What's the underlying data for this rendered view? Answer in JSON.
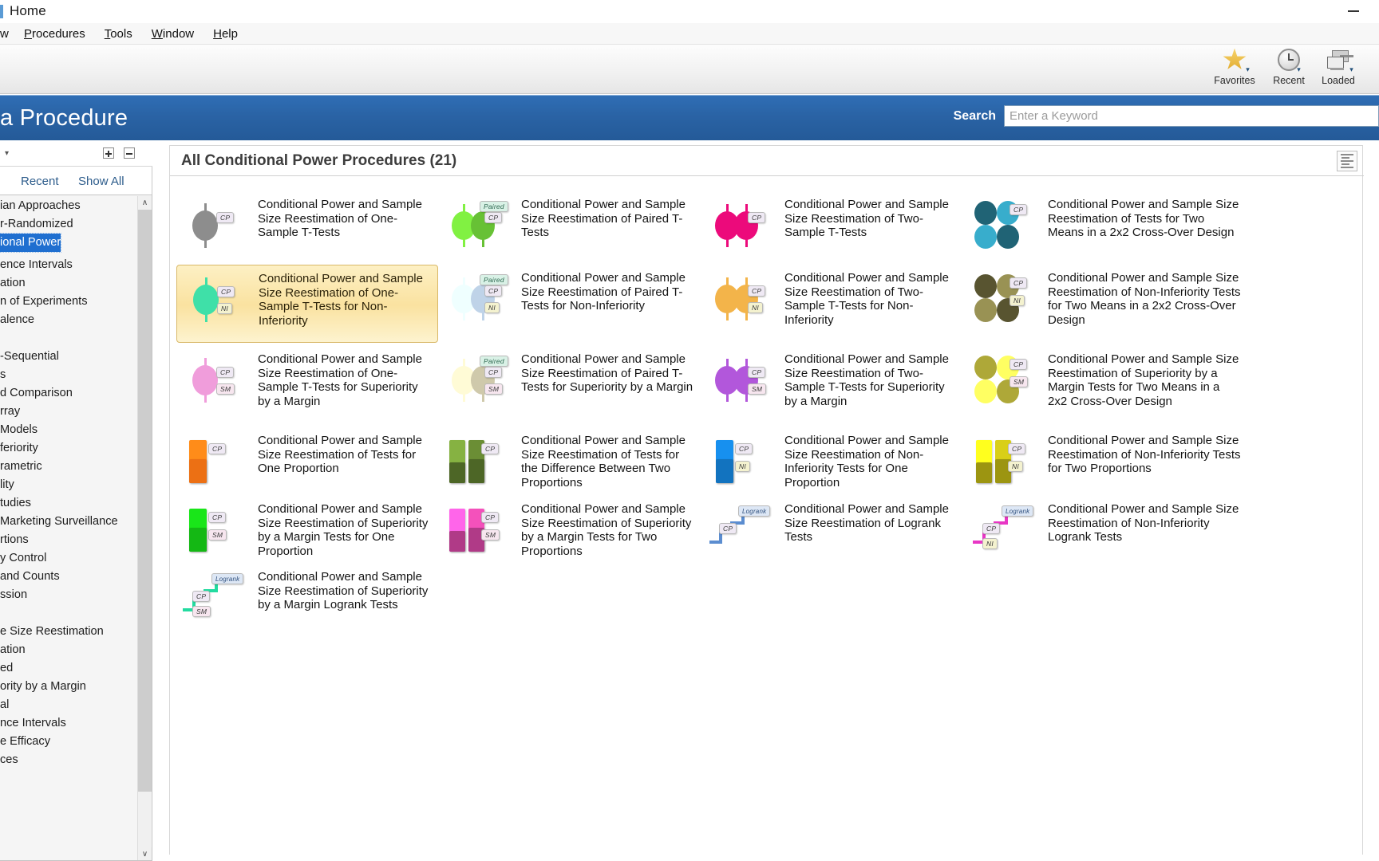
{
  "window": {
    "title": "Home",
    "minimize_label": "—"
  },
  "menubar": {
    "clipped_item": "w",
    "items": [
      "Procedures",
      "Tools",
      "Window",
      "Help"
    ]
  },
  "ribbon": {
    "groups": [
      {
        "label": "Favorites",
        "icon": "star-icon",
        "caret": "▾"
      },
      {
        "label": "Recent",
        "icon": "clock-icon",
        "caret": "▾"
      },
      {
        "label": "Loaded",
        "icon": "windows-icon",
        "caret": "▾"
      }
    ]
  },
  "banner": {
    "title": "a Procedure",
    "search_label": "Search",
    "search_value": "",
    "search_placeholder": "Enter a Keyword",
    "color": "#2a63a5"
  },
  "sidebar": {
    "expand_icon": "expand-all-icon",
    "collapse_icon": "collapse-all-icon",
    "tabs": [
      {
        "label": "Recent"
      },
      {
        "label": "Show All"
      }
    ],
    "selected_item": "ional Power",
    "items": [
      "ian Approaches",
      "r-Randomized",
      "ional Power",
      "ence Intervals",
      "ation",
      "n of Experiments",
      "alence",
      "",
      "-Sequential",
      "s",
      "d Comparison",
      "rray",
      "Models",
      "feriority",
      "rametric",
      "lity",
      "tudies",
      "Marketing Surveillance",
      "rtions",
      "y Control",
      "and Counts",
      "ssion",
      "",
      "e Size Reestimation",
      "ation",
      "ed",
      "ority by a Margin",
      "al",
      "nce Intervals",
      "e Efficacy",
      "ces"
    ],
    "scroll_up": "∧",
    "scroll_down": "∨"
  },
  "main": {
    "title": "All Conditional Power Procedures (21)",
    "view_toggle_icon": "list-view-icon",
    "procedures": [
      {
        "caption": "Conditional Power and Sample Size Reestimation of One-Sample T-Tests",
        "icon": "one-sample-t-test-icon",
        "tags": [
          "CP"
        ],
        "color": "#8d8d8d",
        "selected": false
      },
      {
        "caption": "Conditional Power and Sample Size Reestimation of Paired T-Tests",
        "icon": "paired-t-test-icon",
        "tags": [
          "Paired",
          "CP"
        ],
        "color": "#67c135",
        "selected": false
      },
      {
        "caption": "Conditional Power and Sample Size Reestimation of Two-Sample T-Tests",
        "icon": "two-sample-t-test-icon",
        "tags": [
          "CP"
        ],
        "color": "#ec0a7b",
        "selected": false
      },
      {
        "caption": "Conditional Power and Sample Size Reestimation of Tests for Two Means in a 2x2 Cross-Over Design",
        "icon": "crossover-two-means-icon",
        "tags": [
          "CP"
        ],
        "color": "#2d8aa3",
        "selected": false
      },
      {
        "caption": "Conditional Power and Sample Size Reestimation of One-Sample T-Tests for Non-Inferiority",
        "icon": "one-sample-ni-icon",
        "tags": [
          "CP",
          "NI"
        ],
        "color": "#3fe0a8",
        "selected": true
      },
      {
        "caption": "Conditional Power and Sample Size Reestimation of Paired T-Tests for Non-Inferiority",
        "icon": "paired-ni-icon",
        "tags": [
          "Paired",
          "CP",
          "NI"
        ],
        "color": "#bfd3e8",
        "selected": false
      },
      {
        "caption": "Conditional Power and Sample Size Reestimation of Two-Sample T-Tests for Non-Inferiority",
        "icon": "two-sample-ni-icon",
        "tags": [
          "CP",
          "NI"
        ],
        "color": "#f3b44a",
        "selected": false
      },
      {
        "caption": "Conditional Power and Sample Size Reestimation of Non-Inferiority Tests for Two Means in a 2x2 Cross-Over Design",
        "icon": "crossover-ni-icon",
        "tags": [
          "CP",
          "NI"
        ],
        "color": "#7a7543",
        "selected": false
      },
      {
        "caption": "Conditional Power and Sample Size Reestimation of One-Sample T-Tests for Superiority by a Margin",
        "icon": "one-sample-sm-icon",
        "tags": [
          "CP",
          "SM"
        ],
        "color": "#f09ddb",
        "selected": false
      },
      {
        "caption": "Conditional Power and Sample Size Reestimation of Paired T-Tests for Superiority by a Margin",
        "icon": "paired-sm-icon",
        "tags": [
          "Paired",
          "CP",
          "SM"
        ],
        "color": "#cfc9ab",
        "selected": false
      },
      {
        "caption": "Conditional Power and Sample Size Reestimation of Two-Sample T-Tests for Superiority by a Margin",
        "icon": "two-sample-sm-icon",
        "tags": [
          "CP",
          "SM"
        ],
        "color": "#b257db",
        "selected": false
      },
      {
        "caption": "Conditional Power and Sample Size Reestimation of Superiority by a Margin Tests for Two Means in a 2x2 Cross-Over Design",
        "icon": "crossover-sm-icon",
        "tags": [
          "CP",
          "SM"
        ],
        "color": "#f2ea4e",
        "selected": false
      },
      {
        "caption": "Conditional Power and Sample Size Reestimation of Tests for One Proportion",
        "icon": "one-proportion-icon",
        "tags": [
          "CP"
        ],
        "color": "#ec7014",
        "selected": false
      },
      {
        "caption": "Conditional Power and Sample Size Reestimation of Tests for the Difference Between Two Proportions",
        "icon": "two-proportions-icon",
        "tags": [
          "CP"
        ],
        "color": "#6b8e35",
        "selected": false
      },
      {
        "caption": "Conditional Power and Sample Size Reestimation of Non-Inferiority Tests for One Proportion",
        "icon": "one-proportion-ni-icon",
        "tags": [
          "CP",
          "NI"
        ],
        "color": "#1273bf",
        "selected": false
      },
      {
        "caption": "Conditional Power and Sample Size Reestimation of Non-Inferiority Tests for Two Proportions",
        "icon": "two-proportions-ni-icon",
        "tags": [
          "CP",
          "NI"
        ],
        "color": "#d9cf18",
        "selected": false
      },
      {
        "caption": "Conditional Power and Sample Size Reestimation of Superiority by a Margin Tests for One Proportion",
        "icon": "one-proportion-sm-icon",
        "tags": [
          "CP",
          "SM"
        ],
        "color": "#14b814",
        "selected": false
      },
      {
        "caption": "Conditional Power and Sample Size Reestimation of Superiority by a Margin Tests for Two Proportions",
        "icon": "two-proportions-sm-icon",
        "tags": [
          "CP",
          "SM"
        ],
        "color": "#f451bb",
        "selected": false
      },
      {
        "caption": "Conditional Power and Sample Size Reestimation of Logrank Tests",
        "icon": "logrank-icon",
        "tags": [
          "Logrank",
          "CP"
        ],
        "color": "#5b8dd0",
        "selected": false
      },
      {
        "caption": "Conditional Power and Sample Size Reestimation of Non-Inferiority Logrank Tests",
        "icon": "logrank-ni-icon",
        "tags": [
          "Logrank",
          "CP",
          "NI"
        ],
        "color": "#e837c5",
        "selected": false
      },
      {
        "caption": "Conditional Power and Sample Size Reestimation of Superiority by a Margin Logrank Tests",
        "icon": "logrank-sm-icon",
        "tags": [
          "Logrank",
          "CP",
          "SM"
        ],
        "color": "#23dba0",
        "selected": false
      }
    ]
  }
}
